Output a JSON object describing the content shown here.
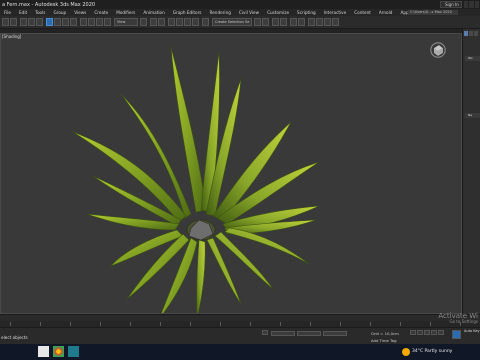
{
  "titlebar": {
    "title": "a Fern.max - Autodesk 3ds Max 2020",
    "signin_label": "Sign In"
  },
  "menubar": {
    "items": [
      "File",
      "Edit",
      "Tools",
      "Group",
      "Views",
      "Create",
      "Modifiers",
      "Animation",
      "Graph Editors",
      "Rendering",
      "Civil View",
      "Customize",
      "Scripting",
      "Interactive",
      "Content",
      "Arnold",
      "App Store",
      "Help"
    ],
    "workspace_label": "C:\\Users\\Ü...s Max 2020"
  },
  "toolbar": {
    "view_dropdown": "View",
    "selection_set_placeholder": "Create Selection Se"
  },
  "viewport": {
    "label": "[Shading]"
  },
  "cmdpanel": {
    "section_1": "Wo",
    "section_2": "Na"
  },
  "statusbar": {
    "selection_text": "elect objects",
    "grid_label": "Grid = 10,0cm",
    "time_tag": "Add Time Tag",
    "auto_key": "Auto Key"
  },
  "watermark": {
    "line1": "Activate Wi",
    "line2": "Go to Settings"
  },
  "taskbar": {
    "weather": "34°C  Partly sunny"
  },
  "colors": {
    "viewport_bg": "#393939",
    "accent_blue": "#2a6db0",
    "leaf_green": "#8fae2a"
  }
}
